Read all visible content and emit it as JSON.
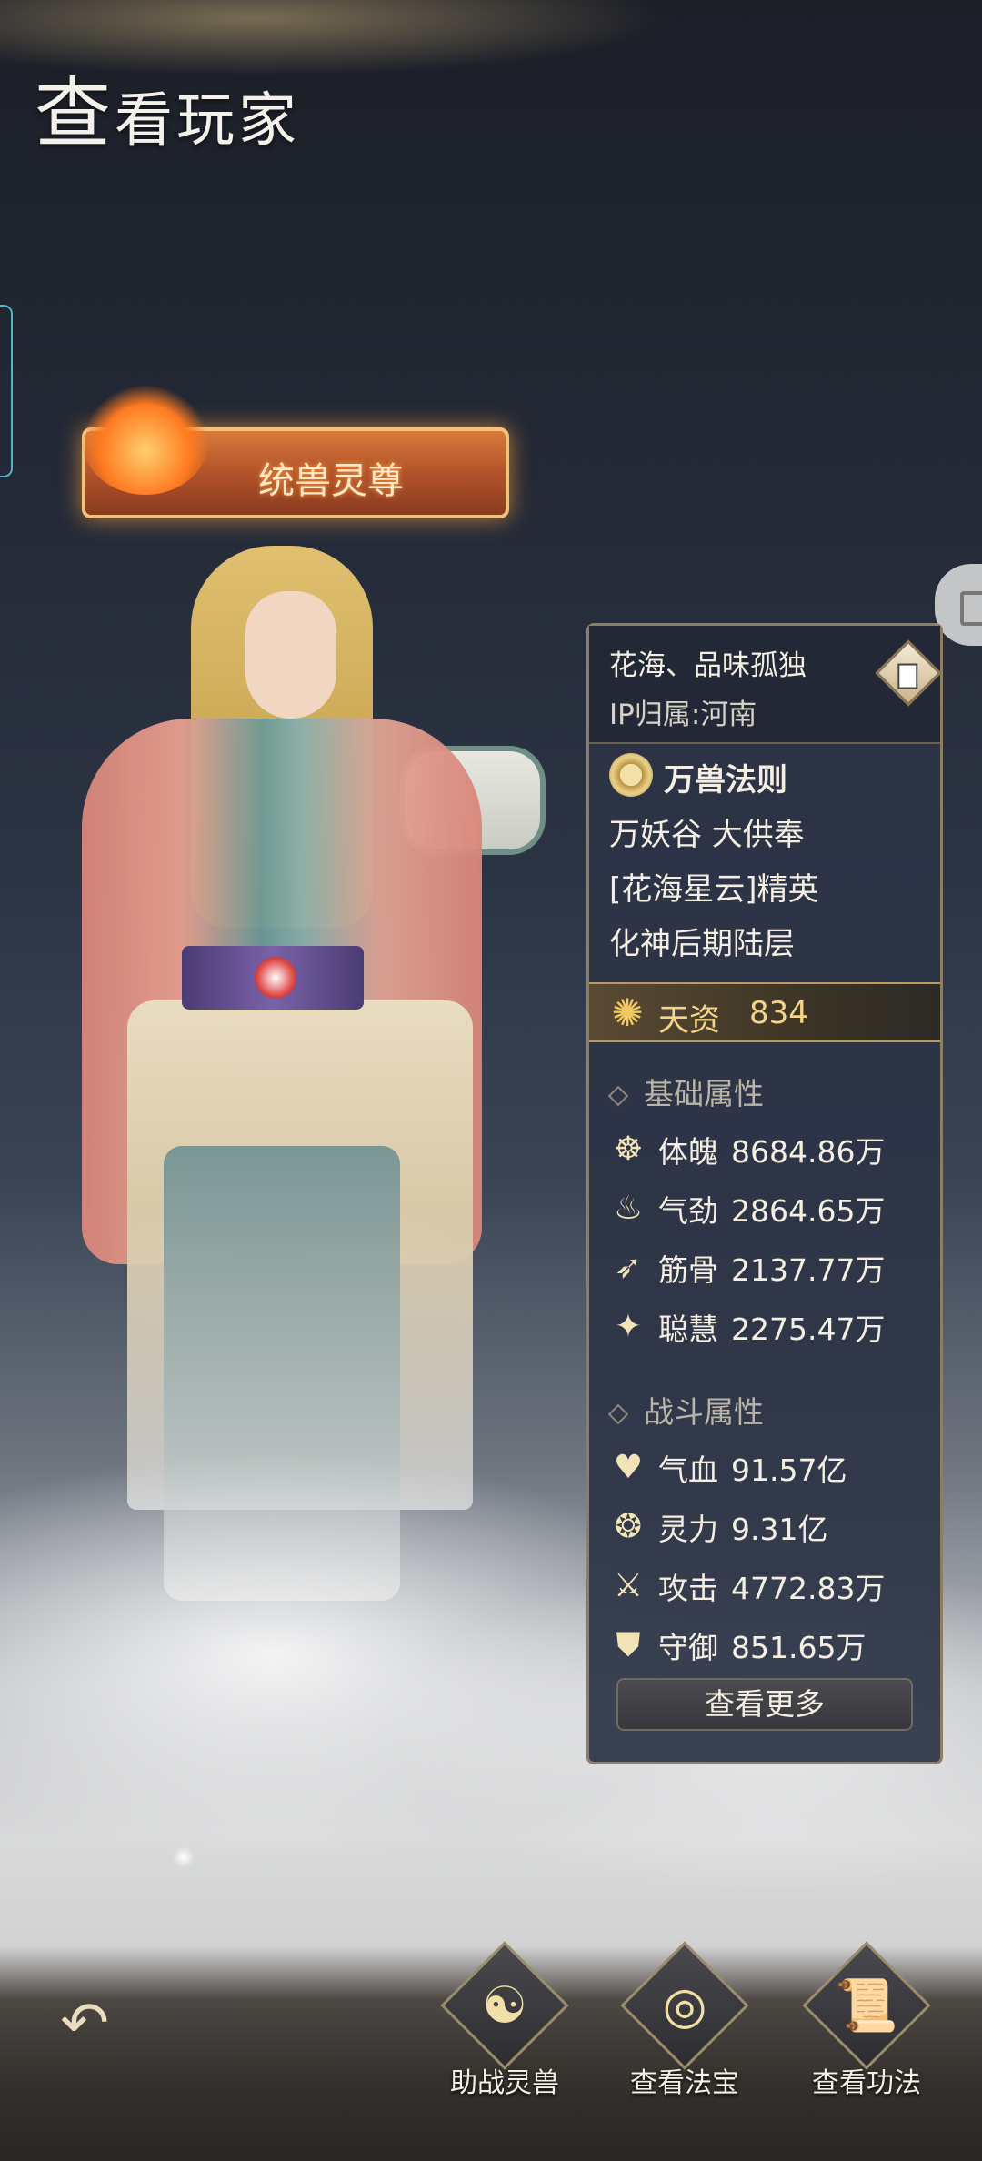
{
  "header": {
    "title_first": "查",
    "title_rest": "看玩家"
  },
  "banner": {
    "title": "统兽灵尊"
  },
  "player": {
    "name": "花海、品味孤独",
    "ip": "IP归属:河南",
    "law": "万兽法则",
    "sect": "万妖谷 大供奉",
    "guild": "[花海星云]精英",
    "realm": "化神后期陆层"
  },
  "talent": {
    "label": "天资",
    "value": "834"
  },
  "base_attributes": {
    "title": "基础属性",
    "items": [
      {
        "icon": "meditation-icon",
        "name": "体魄",
        "value": "8684.86万"
      },
      {
        "icon": "flame-swirl-icon",
        "name": "气劲",
        "value": "2864.65万"
      },
      {
        "icon": "feather-icon",
        "name": "筋骨",
        "value": "2137.77万"
      },
      {
        "icon": "sparkle-icon",
        "name": "聪慧",
        "value": "2275.47万"
      }
    ]
  },
  "battle_attributes": {
    "title": "战斗属性",
    "items": [
      {
        "icon": "heart-icon",
        "name": "气血",
        "value": "91.57亿"
      },
      {
        "icon": "spirit-flame-icon",
        "name": "灵力",
        "value": "9.31亿"
      },
      {
        "icon": "crossed-swords-icon",
        "name": "攻击",
        "value": "4772.83万"
      },
      {
        "icon": "shield-icon",
        "name": "守御",
        "value": "851.65万"
      }
    ]
  },
  "buttons": {
    "view_more": "查看更多",
    "assist_beast": "助战灵兽",
    "view_treasure": "查看法宝",
    "view_skill": "查看功法"
  },
  "colors": {
    "accent_gold": "#f3d488",
    "panel_bg": "#2c3446",
    "banner_orange": "#d77a3a"
  }
}
